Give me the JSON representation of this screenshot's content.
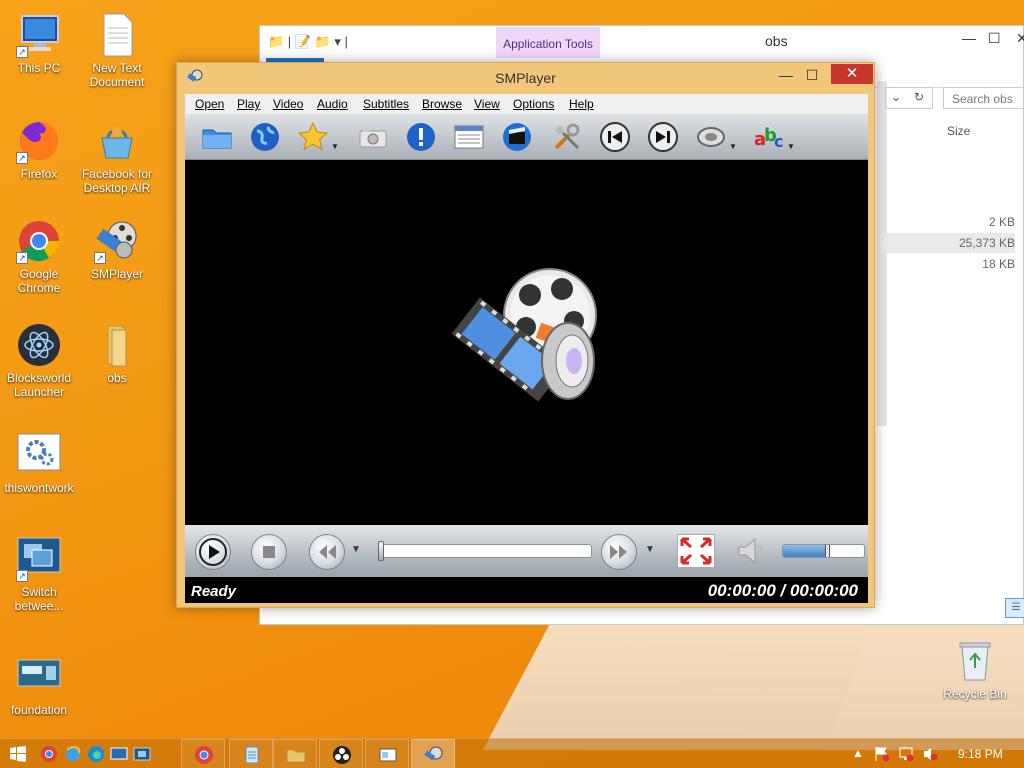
{
  "desktop": {
    "icons": [
      {
        "label": "This PC"
      },
      {
        "label": "New Text Document"
      },
      {
        "label": "Firefox"
      },
      {
        "label": "Facebook for Desktop AIR"
      },
      {
        "label": "Google Chrome"
      },
      {
        "label": "SMPlayer"
      },
      {
        "label": "Blocksworld Launcher"
      },
      {
        "label": "obs"
      },
      {
        "label": "thiswontwork"
      },
      {
        "label": "Switch betwee..."
      },
      {
        "label": "foundation"
      },
      {
        "label": "Recycle Bin"
      }
    ]
  },
  "explorer": {
    "title": "obs",
    "context_tab": "Application Tools",
    "search_placeholder": "Search obs",
    "column_size": "Size",
    "rows": [
      {
        "size": "2 KB"
      },
      {
        "size": "25,373 KB"
      },
      {
        "size": "18 KB"
      }
    ]
  },
  "smplayer": {
    "title": "SMPlayer",
    "menu": [
      "Open",
      "Play",
      "Video",
      "Audio",
      "Subtitles",
      "Browse",
      "View",
      "Options",
      "Help"
    ],
    "toolbar_icons": [
      "open-folder-icon",
      "globe-icon",
      "favorites-star-icon",
      "screenshot-camera-icon",
      "info-icon",
      "playlist-icon",
      "video-clapper-icon",
      "preferences-tools-icon",
      "previous-icon",
      "next-icon",
      "audio-track-icon",
      "subtitles-abc-icon"
    ],
    "status": "Ready",
    "time": "00:00:00 / 00:00:00",
    "seek_position": 0,
    "volume_level": 0.55,
    "accent_close": "#c7372f"
  },
  "taskbar": {
    "time": "9:18 PM"
  }
}
